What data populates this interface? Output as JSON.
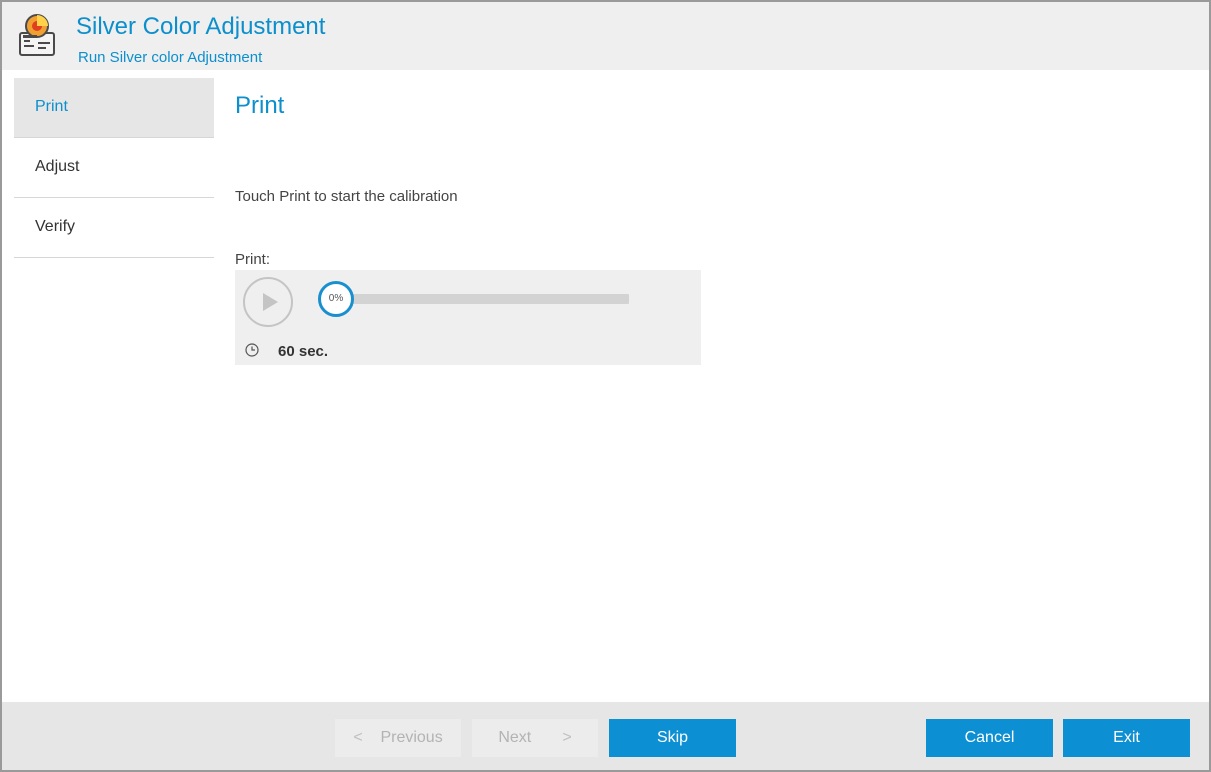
{
  "window": {
    "title": "Silver Color Adjustment",
    "subtitle": "Run Silver color Adjustment",
    "icon": "printer-palette-icon"
  },
  "sidebar": {
    "items": [
      {
        "label": "Print",
        "active": true
      },
      {
        "label": "Adjust",
        "active": false
      },
      {
        "label": "Verify",
        "active": false
      }
    ]
  },
  "main": {
    "title": "Print",
    "instruction": "Touch Print to start the calibration",
    "print_label": "Print:",
    "progress": {
      "percent_label": "0%",
      "value": 0
    },
    "duration": "60 sec."
  },
  "footer": {
    "previous": {
      "label": "Previous",
      "arrow": "<",
      "enabled": false
    },
    "next": {
      "label": "Next",
      "arrow": ">",
      "enabled": false
    },
    "skip": "Skip",
    "cancel": "Cancel",
    "exit": "Exit"
  },
  "colors": {
    "accent": "#0c8fcc",
    "button": "#0c8fd3",
    "panel": "#efefef"
  }
}
